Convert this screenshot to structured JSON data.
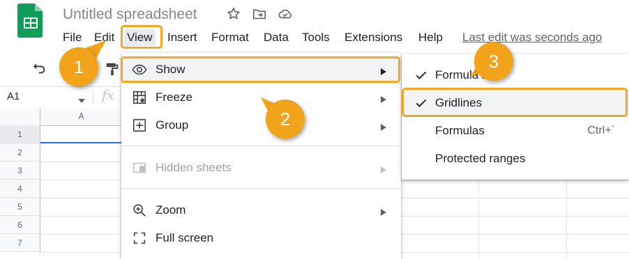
{
  "doc": {
    "title": "Untitled spreadsheet",
    "star_icon": "star-icon",
    "move_icon": "move-to-folder-icon",
    "cloud_icon": "cloud-status-icon"
  },
  "menubar": {
    "items": [
      "File",
      "Edit",
      "View",
      "Insert",
      "Format",
      "Data",
      "Tools",
      "Extensions",
      "Help"
    ],
    "last_edit": "Last edit was seconds ago"
  },
  "formula_bar": {
    "namebox": "A1",
    "fx": "fx"
  },
  "grid": {
    "column_a": "A",
    "rows": [
      "1",
      "2",
      "3",
      "4",
      "5",
      "6",
      "7"
    ]
  },
  "view_menu": {
    "items": [
      {
        "label": "Show",
        "icon": "eye-icon",
        "submenu": true
      },
      {
        "label": "Freeze",
        "icon": "freeze-grid-icon",
        "submenu": true
      },
      {
        "label": "Group",
        "icon": "group-plus-icon",
        "submenu": true
      },
      {
        "label": "Hidden sheets",
        "icon": "hidden-sheets-icon",
        "submenu": true,
        "disabled": true
      },
      {
        "label": "Zoom",
        "icon": "zoom-in-icon",
        "submenu": true
      },
      {
        "label": "Full screen",
        "icon": "fullscreen-icon",
        "submenu": false
      }
    ]
  },
  "show_submenu": {
    "items": [
      {
        "label": "Formula bar",
        "checked": true,
        "shortcut": ""
      },
      {
        "label": "Gridlines",
        "checked": true,
        "shortcut": ""
      },
      {
        "label": "Formulas",
        "checked": false,
        "shortcut": "Ctrl+`"
      },
      {
        "label": "Protected ranges",
        "checked": false,
        "shortcut": ""
      }
    ]
  },
  "callouts": {
    "step1": "1",
    "step2": "2",
    "step3": "3"
  },
  "colors": {
    "highlight": "#f5a623",
    "badge": "#f1a31a",
    "sheets_green": "#0f9d58",
    "selection_blue": "#1a73e8"
  }
}
